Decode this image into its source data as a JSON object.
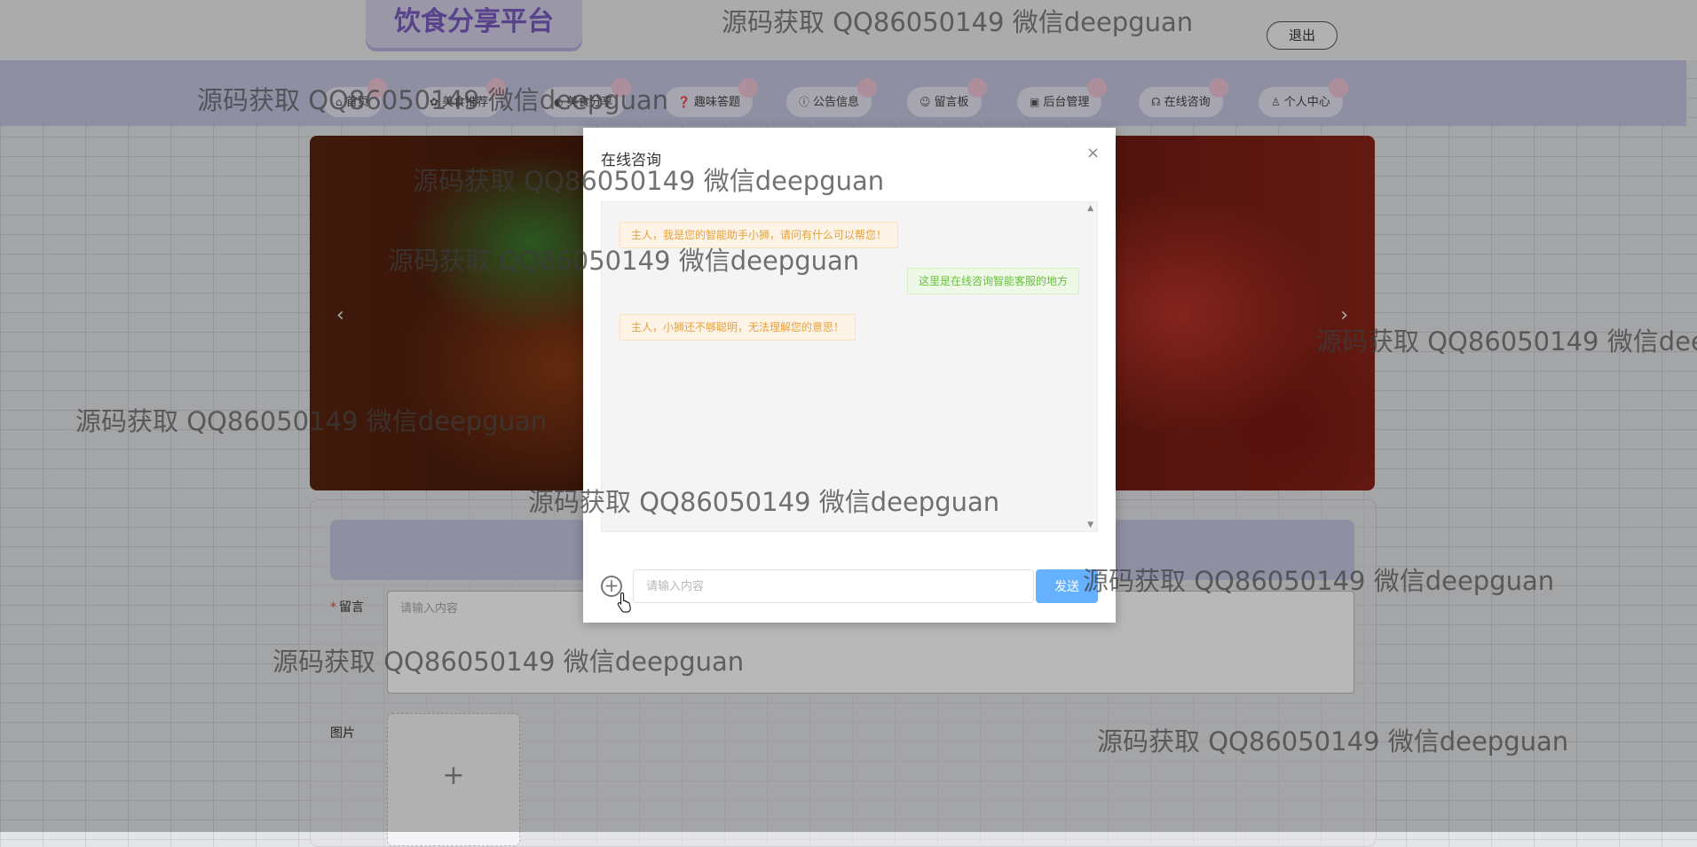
{
  "header": {
    "logo_text": "饮食分享平台",
    "logout_label": "退出"
  },
  "nav": [
    {
      "icon": "home-icon",
      "label": "首页"
    },
    {
      "icon": "food-icon",
      "label": "美食推荐"
    },
    {
      "icon": "share-icon",
      "label": "美食分享"
    },
    {
      "icon": "question-icon",
      "label": "趣味答题"
    },
    {
      "icon": "info-icon",
      "label": "公告信息"
    },
    {
      "icon": "message-icon",
      "label": "留言板"
    },
    {
      "icon": "admin-icon",
      "label": "后台管理"
    },
    {
      "icon": "headset-icon",
      "label": "在线咨询"
    },
    {
      "icon": "user-icon",
      "label": "个人中心"
    }
  ],
  "banner": {
    "prev": "‹",
    "next": "›"
  },
  "form": {
    "message_label": "留言",
    "message_placeholder": "请输入内容",
    "image_label": "图片",
    "upload_symbol": "+"
  },
  "dialog": {
    "title": "在线咨询",
    "close_symbol": "×",
    "messages": [
      {
        "from": "bot",
        "text": "主人，我是您的智能助手小狮，请问有什么可以帮您！"
      },
      {
        "from": "user",
        "text": "这里是在线咨询智能客服的地方"
      },
      {
        "from": "bot",
        "text": "主人，小狮还不够聪明，无法理解您的意思！"
      }
    ],
    "input_placeholder": "请输入内容",
    "input_value": "",
    "send_label": "发送"
  },
  "watermark": "源码获取 QQ86050149 微信deepguan"
}
